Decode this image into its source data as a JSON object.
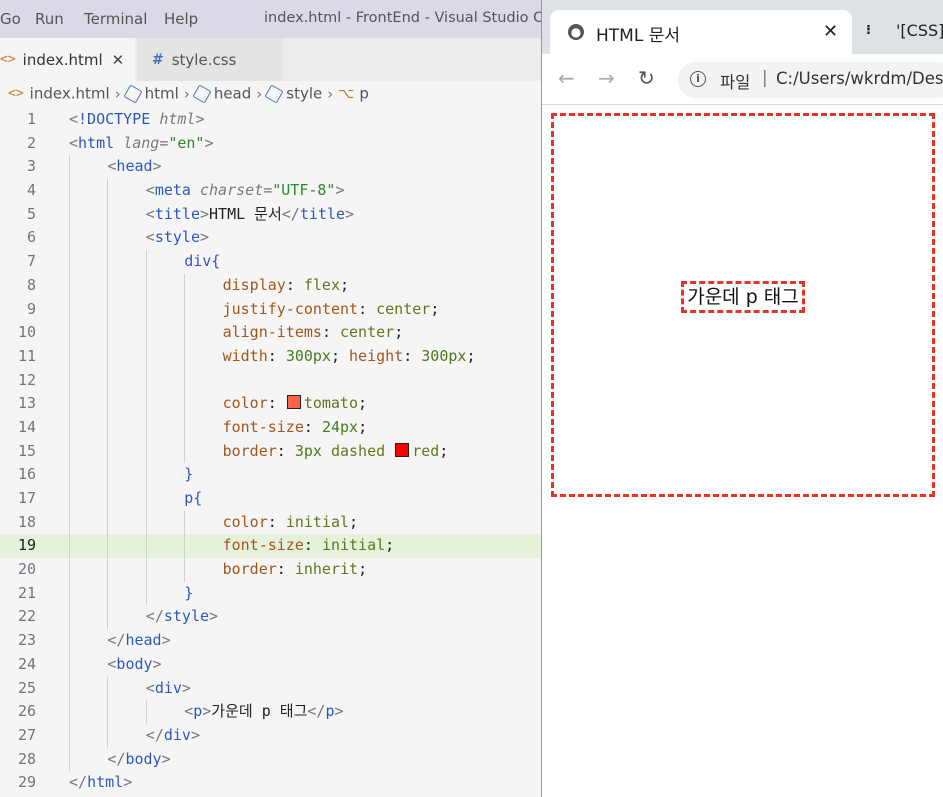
{
  "menu": [
    "Go",
    "Run",
    "Terminal",
    "Help"
  ],
  "window_title": "index.html - FrontEnd - Visual Studio Code",
  "editor_tabs": [
    {
      "label": "index.html",
      "icon": "html-file-icon",
      "active": true
    },
    {
      "label": "style.css",
      "icon": "css-file-icon",
      "active": false
    }
  ],
  "breadcrumb": [
    "index.html",
    "html",
    "head",
    "style",
    "p"
  ],
  "code_lines": [
    {
      "n": "1",
      "indent": 0,
      "cur": false,
      "html": "<span class='p'>&lt;</span><span class='tg'>!DOCTYPE</span> <span class='an'>html</span><span class='p'>&gt;</span>"
    },
    {
      "n": "2",
      "indent": 0,
      "cur": false,
      "html": "<span class='p'>&lt;</span><span class='tg'>html</span> <span class='an'>lang</span><span class='p'>=</span><span class='av'>\"en\"</span><span class='p'>&gt;</span>"
    },
    {
      "n": "3",
      "indent": 1,
      "cur": false,
      "html": "<span class='p'>&lt;</span><span class='tg'>head</span><span class='p'>&gt;</span>"
    },
    {
      "n": "4",
      "indent": 2,
      "cur": false,
      "html": "<span class='p'>&lt;</span><span class='tg'>meta</span> <span class='an'>charset</span><span class='p'>=</span><span class='av'>\"UTF-8\"</span><span class='p'>&gt;</span>"
    },
    {
      "n": "5",
      "indent": 2,
      "cur": false,
      "html": "<span class='p'>&lt;</span><span class='tg'>title</span><span class='p'>&gt;</span><span class='tx'>HTML 문서</span><span class='p'>&lt;/</span><span class='tg'>title</span><span class='p'>&gt;</span>"
    },
    {
      "n": "6",
      "indent": 2,
      "cur": false,
      "html": "<span class='p'>&lt;</span><span class='tg'>style</span><span class='p'>&gt;</span>"
    },
    {
      "n": "7",
      "indent": 3,
      "cur": false,
      "html": "<span class='tg'>div</span><span class='tg'>{</span>"
    },
    {
      "n": "8",
      "indent": 4,
      "cur": false,
      "html": "<span class='pr'>display</span><span class='tx'>: </span><span class='vl'>flex</span><span class='tx'>;</span>"
    },
    {
      "n": "9",
      "indent": 4,
      "cur": false,
      "html": "<span class='pr'>justify-content</span><span class='tx'>: </span><span class='vl'>center</span><span class='tx'>;</span>"
    },
    {
      "n": "10",
      "indent": 4,
      "cur": false,
      "html": "<span class='pr'>align-items</span><span class='tx'>: </span><span class='vl'>center</span><span class='tx'>;</span>"
    },
    {
      "n": "11",
      "indent": 4,
      "cur": false,
      "html": "<span class='pr'>width</span><span class='tx'>: </span><span class='nm'>300px</span><span class='tx'>; </span><span class='pr'>height</span><span class='tx'>: </span><span class='nm'>300px</span><span class='tx'>;</span>"
    },
    {
      "n": "12",
      "indent": 4,
      "cur": false,
      "html": ""
    },
    {
      "n": "13",
      "indent": 4,
      "cur": false,
      "html": "<span class='pr'>color</span><span class='tx'>: </span><span class='sw' style='background:#ff6347'></span><span class='vl'>tomato</span><span class='tx'>;</span>"
    },
    {
      "n": "14",
      "indent": 4,
      "cur": false,
      "html": "<span class='pr'>font-size</span><span class='tx'>: </span><span class='nm'>24px</span><span class='tx'>;</span>"
    },
    {
      "n": "15",
      "indent": 4,
      "cur": false,
      "html": "<span class='pr'>border</span><span class='tx'>: </span><span class='nm'>3px</span> <span class='vl'>dashed</span> <span class='sw' style='background:#ff0000'></span><span class='vl'>red</span><span class='tx'>;</span>"
    },
    {
      "n": "16",
      "indent": 3,
      "cur": false,
      "html": "<span class='tg'>}</span>"
    },
    {
      "n": "17",
      "indent": 3,
      "cur": false,
      "html": "<span class='tg'>p</span><span class='tg'>{</span>"
    },
    {
      "n": "18",
      "indent": 4,
      "cur": false,
      "html": "<span class='pr'>color</span><span class='tx'>: </span><span class='vl'>initial</span><span class='tx'>;</span>"
    },
    {
      "n": "19",
      "indent": 4,
      "cur": true,
      "html": "<span class='pr'>font-size</span><span class='tx'>: </span><span class='vl'>initial</span><span class='tx'>;</span>"
    },
    {
      "n": "20",
      "indent": 4,
      "cur": false,
      "html": "<span class='pr'>border</span><span class='tx'>: </span><span class='vl'>inherit</span><span class='tx'>;</span>"
    },
    {
      "n": "21",
      "indent": 3,
      "cur": false,
      "html": "<span class='tg'>}</span>"
    },
    {
      "n": "22",
      "indent": 2,
      "cur": false,
      "html": "<span class='p'>&lt;/</span><span class='tg'>style</span><span class='p'>&gt;</span>"
    },
    {
      "n": "23",
      "indent": 1,
      "cur": false,
      "html": "<span class='p'>&lt;/</span><span class='tg'>head</span><span class='p'>&gt;</span>"
    },
    {
      "n": "24",
      "indent": 1,
      "cur": false,
      "html": "<span class='p'>&lt;</span><span class='tg'>body</span><span class='p'>&gt;</span>"
    },
    {
      "n": "25",
      "indent": 2,
      "cur": false,
      "html": "<span class='p'>&lt;</span><span class='tg'>div</span><span class='p'>&gt;</span>"
    },
    {
      "n": "26",
      "indent": 3,
      "cur": false,
      "html": "<span class='p'>&lt;</span><span class='tg'>p</span><span class='p'>&gt;</span><span class='tx'>가운데 p 태그</span><span class='p'>&lt;/</span><span class='tg'>p</span><span class='p'>&gt;</span>"
    },
    {
      "n": "27",
      "indent": 2,
      "cur": false,
      "html": "<span class='p'>&lt;/</span><span class='tg'>div</span><span class='p'>&gt;</span>"
    },
    {
      "n": "28",
      "indent": 1,
      "cur": false,
      "html": "<span class='p'>&lt;/</span><span class='tg'>body</span><span class='p'>&gt;</span>"
    },
    {
      "n": "29",
      "indent": 0,
      "cur": false,
      "html": "<span class='p'>&lt;/</span><span class='tg'>html</span><span class='p'>&gt;</span>"
    }
  ],
  "browser": {
    "tab_title": "HTML 문서",
    "tab2_title": "'[CSS]",
    "address_label": "파일",
    "url": "C:/Users/wkrdm/Desk",
    "page_text": "가운데 p 태그",
    "div_border_color": "#e53327"
  }
}
